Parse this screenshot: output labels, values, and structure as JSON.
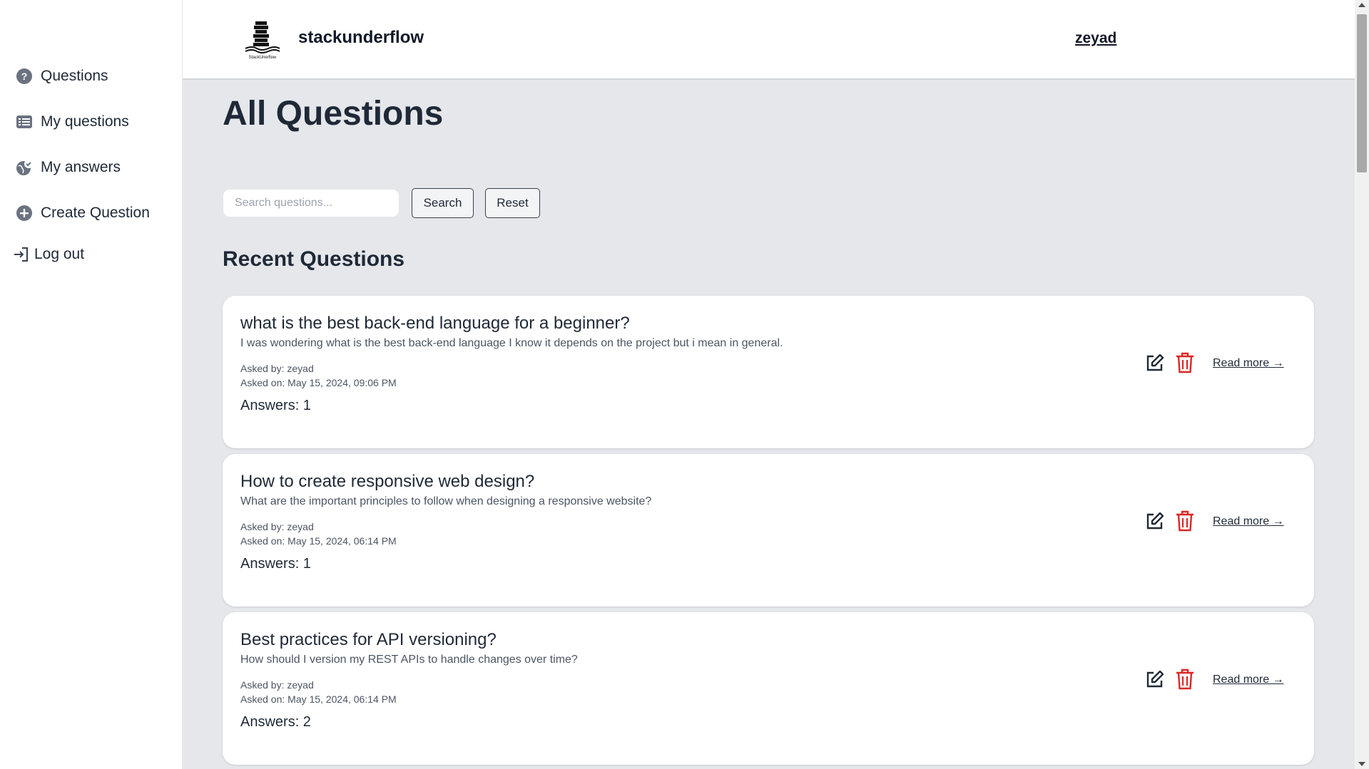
{
  "sidebar": {
    "items": [
      {
        "label": "Questions",
        "icon": "question-circle-icon"
      },
      {
        "label": "My questions",
        "icon": "list-icon"
      },
      {
        "label": "My answers",
        "icon": "globe-check-icon"
      },
      {
        "label": "Create Question",
        "icon": "plus-circle-icon"
      },
      {
        "label": "Log out",
        "icon": "login-arrow-icon"
      }
    ]
  },
  "header": {
    "logo_text": "StackUnerflow",
    "brand": "stackunderflow",
    "user": "zeyad"
  },
  "main": {
    "title": "All Questions",
    "search": {
      "placeholder": "Search questions...",
      "value": ""
    },
    "search_label": "Search",
    "reset_label": "Reset",
    "section_title": "Recent Questions",
    "read_more_label": "Read more →",
    "questions": [
      {
        "title": "what is the best back-end language for a beginner?",
        "body": "I was wondering what is the best back-end language I know it depends on the project but i mean in general.",
        "asked_by": "Asked by: zeyad",
        "asked_on": "Asked on: May 15, 2024, 09:06 PM",
        "answers": "Answers: 1"
      },
      {
        "title": "How to create responsive web design?",
        "body": "What are the important principles to follow when designing a responsive website?",
        "asked_by": "Asked by: zeyad",
        "asked_on": "Asked on: May 15, 2024, 06:14 PM",
        "answers": "Answers: 1"
      },
      {
        "title": "Best practices for API versioning?",
        "body": "How should I version my REST APIs to handle changes over time?",
        "asked_by": "Asked by: zeyad",
        "asked_on": "Asked on: May 15, 2024, 06:14 PM",
        "answers": "Answers: 2"
      }
    ]
  },
  "colors": {
    "background": "#e5e7eb",
    "card": "#ffffff",
    "text": "#1f2937",
    "delete": "#dc2626"
  }
}
